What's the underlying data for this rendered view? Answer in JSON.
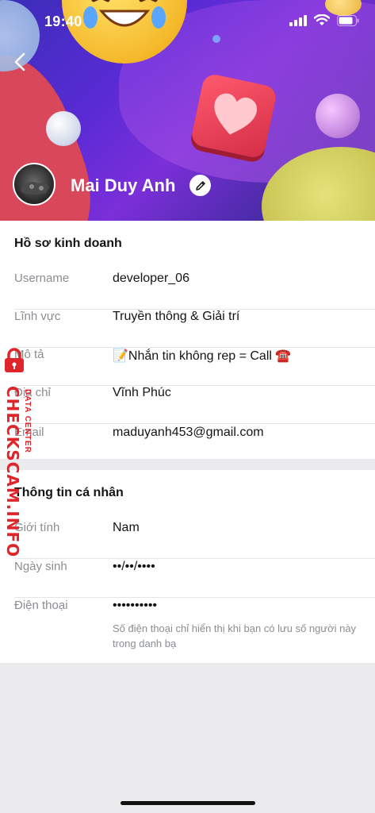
{
  "status_bar": {
    "time": "19:40"
  },
  "profile": {
    "name": "Mai Duy Anh"
  },
  "business_section": {
    "title": "Hồ sơ kinh doanh",
    "rows": [
      {
        "label": "Username",
        "value": "developer_06"
      },
      {
        "label": "Lĩnh vực",
        "value": "Truyền thông & Giải trí"
      },
      {
        "label": "Mô tả",
        "value": "📝Nhắn tin không rep = Call ☎️"
      },
      {
        "label": "Địa chỉ",
        "value": "Vĩnh Phúc"
      },
      {
        "label": "Email",
        "value": "maduyanh453@gmail.com"
      }
    ]
  },
  "personal_section": {
    "title": "Thông tin cá nhân",
    "rows": [
      {
        "label": "Giới tính",
        "value": "Nam"
      },
      {
        "label": "Ngày sinh",
        "value": "••/••/••••"
      },
      {
        "label": "Điện thoại",
        "value": "••••••••••",
        "note": "Số điện thoại chỉ hiển thị khi bạn có lưu số người này trong danh bạ"
      }
    ]
  },
  "watermark": {
    "main": "CHECKSCAM.INFO",
    "sub": "DATA CENTER"
  },
  "icons": [
    "back-chevron-icon",
    "pencil-icon",
    "signal-icon",
    "wifi-icon",
    "battery-icon",
    "lock-icon"
  ],
  "colors": {
    "accent_watermark": "#e0252a",
    "label_gray": "#8a8d91",
    "background": "#ebebed"
  }
}
